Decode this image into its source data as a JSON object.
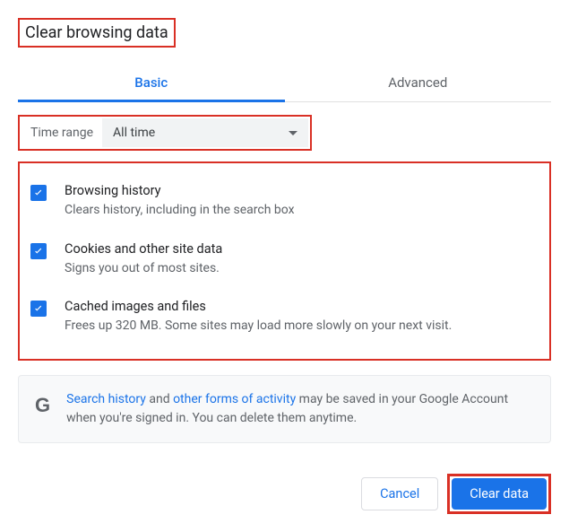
{
  "title": "Clear browsing data",
  "tabs": {
    "basic": "Basic",
    "advanced": "Advanced"
  },
  "timeRange": {
    "label": "Time range",
    "selected": "All time"
  },
  "options": [
    {
      "title": "Browsing history",
      "desc": "Clears history, including in the search box",
      "checked": true
    },
    {
      "title": "Cookies and other site data",
      "desc": "Signs you out of most sites.",
      "checked": true
    },
    {
      "title": "Cached images and files",
      "desc": "Frees up 320 MB. Some sites may load more slowly on your next visit.",
      "checked": true
    }
  ],
  "info": {
    "link1": "Search history",
    "mid1": " and ",
    "link2": "other forms of activity",
    "rest": " may be saved in your Google Account when you're signed in. You can delete them anytime."
  },
  "buttons": {
    "cancel": "Cancel",
    "clear": "Clear data"
  }
}
